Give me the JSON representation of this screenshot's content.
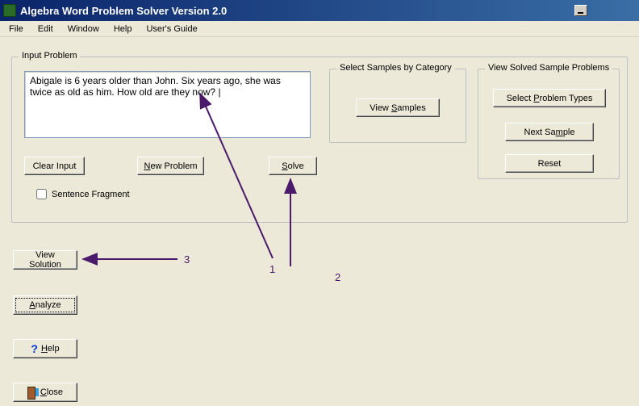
{
  "titlebar": {
    "title": "Algebra Word Problem Solver Version 2.0"
  },
  "menubar": {
    "file": "File",
    "edit": "Edit",
    "window": "Window",
    "help": "Help",
    "users_guide": "User's Guide"
  },
  "input_group": {
    "legend": "Input Problem",
    "problem_text": "Abigale is 6 years older than John. Six years ago, she was twice as old as him. How old are they now? |",
    "clear_input": "Clear Input",
    "new_problem_prefix": "N",
    "new_problem_rest": "ew Problem",
    "solve_prefix": "S",
    "solve_rest": "olve",
    "sentence_fragment": "Sentence Fragment"
  },
  "samples_group": {
    "legend": "Select Samples by Category",
    "view_samples_prefix": "View ",
    "view_samples_accel": "S",
    "view_samples_rest": "amples"
  },
  "solved_group": {
    "legend": "View Solved Sample Problems",
    "select_problem_types_prefix": "Select ",
    "select_problem_types_accel": "P",
    "select_problem_types_rest": "roblem Types",
    "next_sample_prefix": "Next Sa",
    "next_sample_accel": "m",
    "next_sample_rest": "ple",
    "reset": "Reset"
  },
  "left_buttons": {
    "view_solution": "View Solution",
    "analyze_prefix": "A",
    "analyze_rest": "nalyze",
    "help_prefix": "H",
    "help_rest": "elp",
    "close_prefix": "C",
    "close_rest": "lose"
  },
  "annotations": {
    "label1": "1",
    "label2": "2",
    "label3": "3"
  }
}
